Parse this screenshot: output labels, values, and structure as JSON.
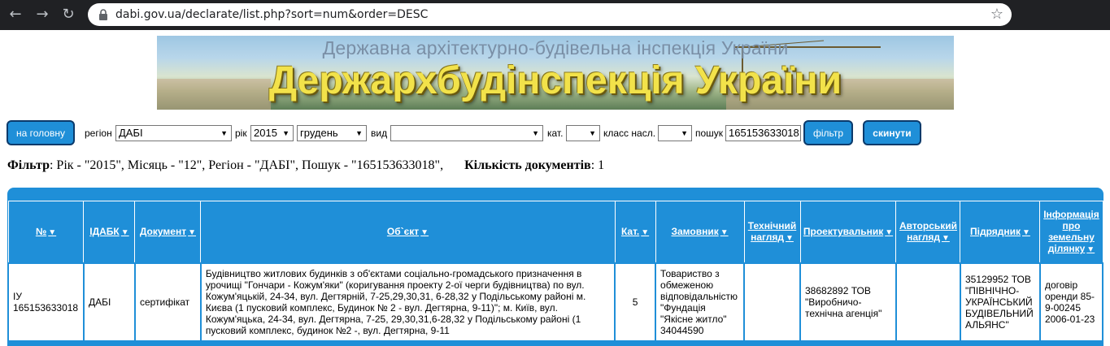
{
  "browser": {
    "url": "dabi.gov.ua/declarate/list.php?sort=num&order=DESC",
    "back_icon": "←",
    "forward_icon": "→",
    "reload_icon": "↻",
    "star_icon": "☆"
  },
  "banner": {
    "subtitle": "Державна архітектурно-будівельна інспекція України",
    "title": "Держархбудінспекція України"
  },
  "toolbar": {
    "home_label": "на головну",
    "region_label": "регіон",
    "region_value": "ДАБІ",
    "year_label": "рік",
    "year_value": "2015",
    "month_value": "грудень",
    "type_label": "вид",
    "type_value": "",
    "cat_label": "кат.",
    "cat_value": "",
    "class_label": "класс насл.",
    "class_value": "",
    "search_label": "пошук",
    "search_value": "165153633018",
    "filter_label": "фільтр",
    "reset_label": "скинути"
  },
  "filter": {
    "label": "Фільтр",
    "text": ": Рік - \"2015\", Місяць - \"12\", Регіон - \"ДАБІ\", Пошук - \"165153633018\",",
    "count_label": "Кількість документів",
    "count_text": ": 1"
  },
  "table": {
    "headers": {
      "num": "№",
      "idabk": "ІДАБК",
      "document": "Документ",
      "object": "Об`єкт",
      "cat": "Кат.",
      "customer": "Замовник",
      "tech_line1": "Технічний",
      "tech_line2": "нагляд",
      "designer": "Проектувальник",
      "author_line1": "Авторський",
      "author_line2": "нагляд",
      "contractor": "Підрядник",
      "land_line1": "Інформація",
      "land_line2": "про",
      "land_line3": "земельну",
      "land_line4": "ділянку"
    },
    "sort_icon": "▼",
    "rows": [
      {
        "num": "ІУ 165153633018",
        "idabk": "ДАБІ",
        "document": "сертифікат",
        "object": "Будівництво житлових будинків з об'єктами соціально-громадського призначення в урочищі \"Гончари - Кожум'яки\" (коригування проекту 2-ої черги будівництва) по вул. Кожум'яцькій, 24-34, вул. Дегтярній, 7-25,29,30,31, 6-28,32 у Подільському районі м. Києва (1 пусковий комплекс, Будинок № 2 - вул. Дегтярна, 9-11)\"; м. Київ, вул. Кожум'яцька, 24-34, вул. Дегтярна, 7-25, 29,30,31,6-28,32 у Подільському районі (1 пусковий комплекс, будинок №2 -, вул. Дегтярна, 9-11",
        "cat": "5",
        "customer": "Товариство з обмеженою відповідальністю \"Фундація \"Якісне житло\" 34044590",
        "tech": "",
        "designer": "38682892 ТОВ \"Виробничо-технічна агенція\"",
        "author": "",
        "contractor": "35129952 ТОВ \"ПІВНІЧНО-УКРАЇНСЬКИЙ БУДІВЕЛЬНИЙ АЛЬЯНС\"",
        "land": "договір оренди 85-9-00245 2006-01-23"
      }
    ]
  },
  "colors": {
    "accent": "#1f8fd8",
    "button_border": "#0b3a6b",
    "chrome": "#202124",
    "banner_title": "#f2e24a"
  }
}
